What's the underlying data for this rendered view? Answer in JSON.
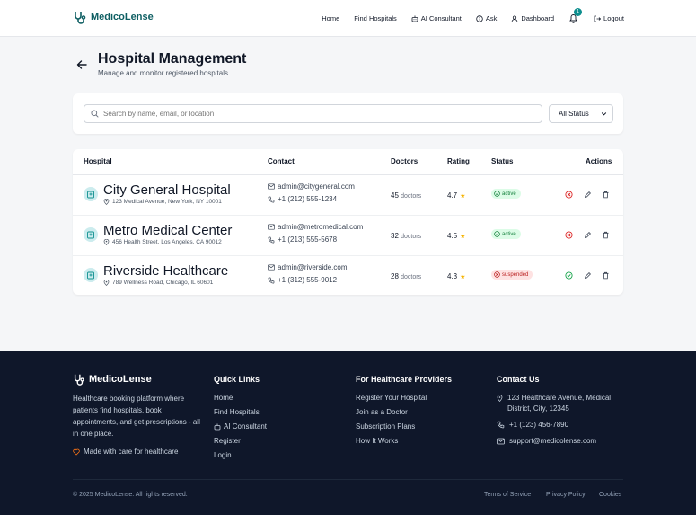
{
  "header": {
    "brand": "MedicoLense",
    "nav": {
      "home": "Home",
      "find_hospitals": "Find Hospitals",
      "ai_consultant": "AI Consultant",
      "ask": "Ask",
      "dashboard": "Dashboard",
      "notification_count": "1",
      "logout": "Logout"
    }
  },
  "page": {
    "title": "Hospital Management",
    "subtitle": "Manage and monitor registered hospitals"
  },
  "filters": {
    "search_placeholder": "Search by name, email, or location",
    "status_selected": "All Status"
  },
  "table": {
    "columns": {
      "hospital": "Hospital",
      "contact": "Contact",
      "doctors": "Doctors",
      "rating": "Rating",
      "status": "Status",
      "actions": "Actions"
    },
    "rows": [
      {
        "name": "City General Hospital",
        "address": "123 Medical Avenue, New York, NY 10001",
        "email": "admin@citygeneral.com",
        "phone": "+1 (212) 555-1234",
        "doctors": "45",
        "doctors_unit": "doctors",
        "rating": "4.7",
        "status": "active"
      },
      {
        "name": "Metro Medical Center",
        "address": "456 Health Street, Los Angeles, CA 90012",
        "email": "admin@metromedical.com",
        "phone": "+1 (213) 555-5678",
        "doctors": "32",
        "doctors_unit": "doctors",
        "rating": "4.5",
        "status": "active"
      },
      {
        "name": "Riverside Healthcare",
        "address": "789 Wellness Road, Chicago, IL 60601",
        "email": "admin@riverside.com",
        "phone": "+1 (312) 555-9012",
        "doctors": "28",
        "doctors_unit": "doctors",
        "rating": "4.3",
        "status": "suspended"
      }
    ]
  },
  "footer": {
    "brand": "MedicoLense",
    "description": "Healthcare booking platform where patients find hospitals, book appointments, and get prescriptions - all in one place.",
    "made_with": "Made with care for healthcare",
    "quick_links": {
      "title": "Quick Links",
      "items": [
        "Home",
        "Find Hospitals",
        "AI Consultant",
        "Register",
        "Login"
      ]
    },
    "providers": {
      "title": "For Healthcare Providers",
      "items": [
        "Register Your Hospital",
        "Join as a Doctor",
        "Subscription Plans",
        "How It Works"
      ]
    },
    "contact": {
      "title": "Contact Us",
      "address": "123 Healthcare Avenue, Medical District, City, 12345",
      "phone": "+1 (123) 456-7890",
      "email": "support@medicolense.com"
    },
    "copyright": "© 2025 MedicoLense. All rights reserved.",
    "legal": {
      "terms": "Terms of Service",
      "privacy": "Privacy Policy",
      "cookies": "Cookies"
    }
  },
  "colors": {
    "brand": "#0f5f63",
    "accent": "#0e8f8f",
    "active": "#15803d",
    "suspended": "#b91c1c",
    "footer_bg": "#0f172a"
  }
}
